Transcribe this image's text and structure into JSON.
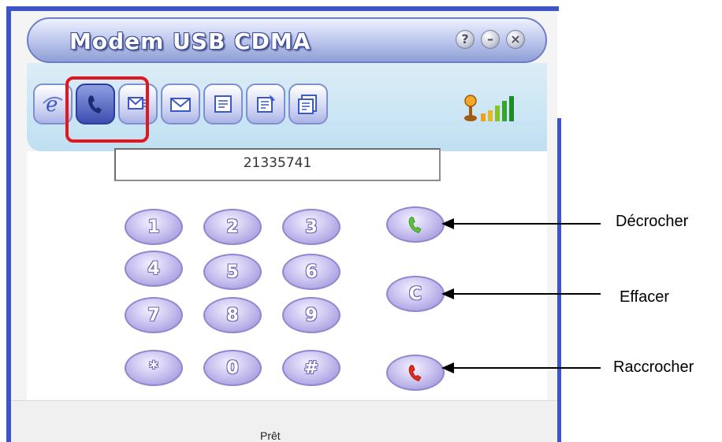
{
  "window": {
    "title": "Modem USB CDMA",
    "help_glyph": "?",
    "minimize_glyph": "–",
    "close_glyph": "×"
  },
  "toolbar": {
    "tabs": [
      {
        "icon": "internet-explorer-icon"
      },
      {
        "icon": "phone-handset-icon",
        "active": true
      },
      {
        "icon": "sms-send-icon"
      },
      {
        "icon": "envelope-icon"
      },
      {
        "icon": "phonebook-icon"
      },
      {
        "icon": "notes-icon"
      },
      {
        "icon": "settings-document-icon"
      }
    ],
    "signal_icon": "signal-strength-icon"
  },
  "dialer": {
    "number": "21335741",
    "keys": [
      "1",
      "2",
      "3",
      "4",
      "5",
      "6",
      "7",
      "8",
      "9",
      "*",
      "0",
      "#"
    ],
    "clear_label": "C"
  },
  "status": {
    "text": "Prêt"
  },
  "annotations": {
    "answer": "Décrocher",
    "clear": "Effacer",
    "hangup": "Raccrocher"
  },
  "colors": {
    "accent_blue": "#3d55c9",
    "key_fill": "#b9b2ea",
    "answer_green": "#5cc13b",
    "hangup_red": "#e02a1c",
    "highlight_red": "#e3161e"
  }
}
